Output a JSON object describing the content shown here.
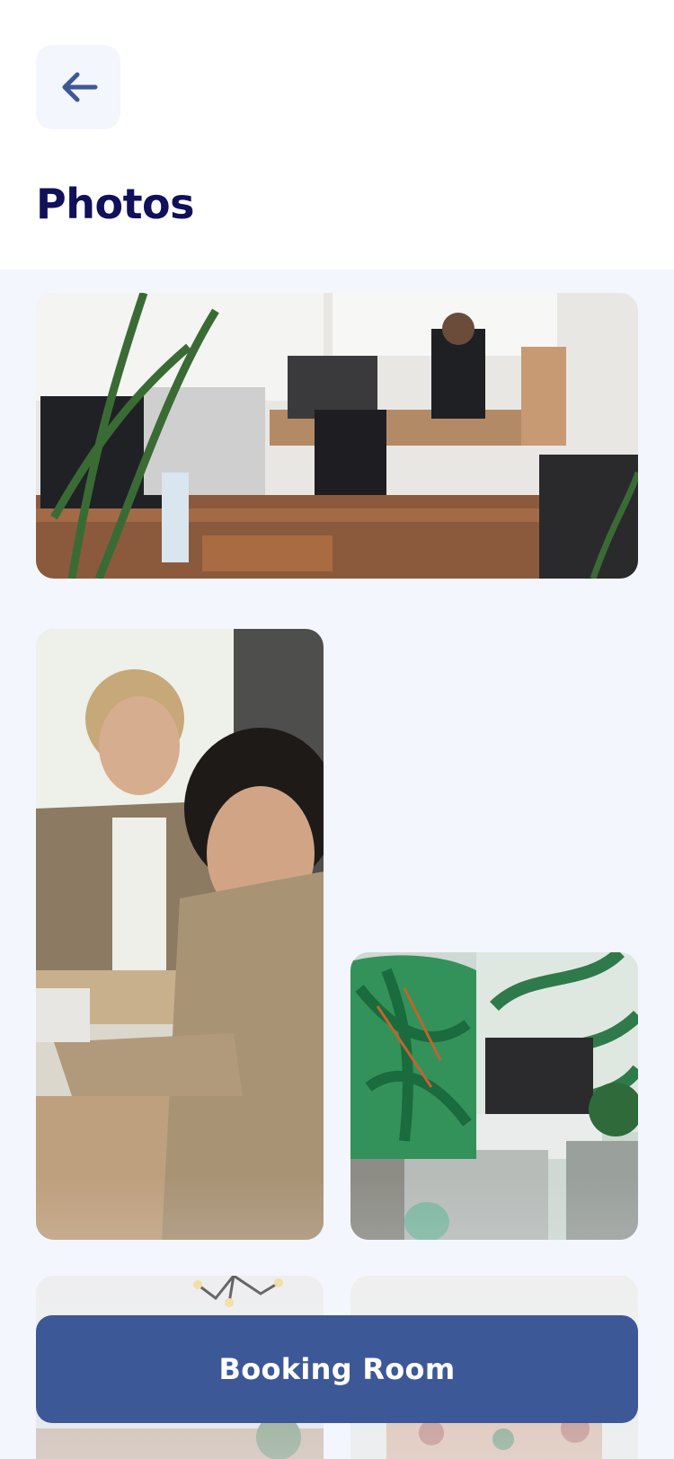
{
  "header": {
    "back_icon": "arrow-left-icon",
    "title": "Photos"
  },
  "gallery": {
    "photos": [
      {
        "subject": "open-plan office with desks and computers"
      },
      {
        "subject": "woman and man working at a desk"
      },
      {
        "subject": "lounge with tropical leaf wallpaper and TV"
      },
      {
        "subject": "office ceiling with pendant light"
      },
      {
        "subject": "office interior with plants"
      }
    ]
  },
  "footer": {
    "booking_label": "Booking Room"
  },
  "colors": {
    "primary": "#3d5897",
    "title": "#11105a",
    "background": "#f3f6fd",
    "header_bg": "#ffffff"
  }
}
